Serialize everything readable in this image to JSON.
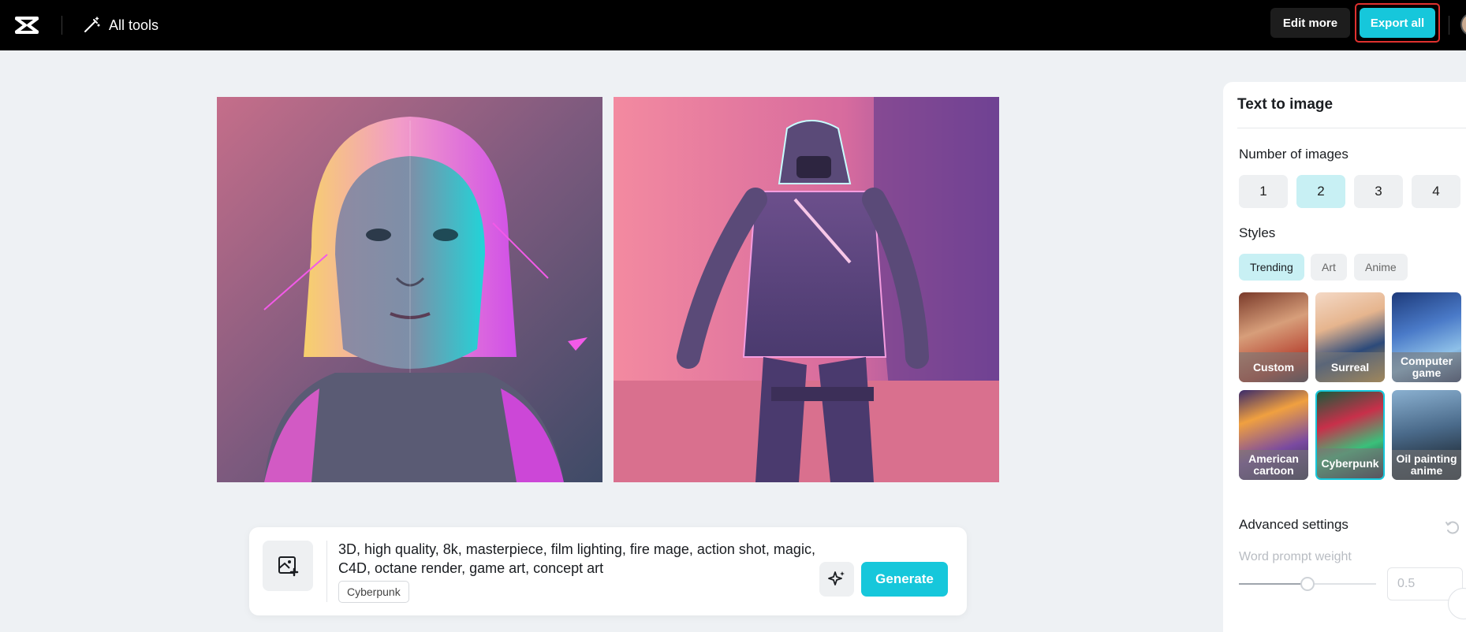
{
  "header": {
    "logo_icon": "capcut-logo-icon",
    "all_tools_label": "All tools",
    "edit_more_label": "Edit more",
    "export_all_label": "Export all"
  },
  "canvas": {
    "images": [
      {
        "subject": "generated-image-1"
      },
      {
        "subject": "generated-image-2"
      }
    ]
  },
  "prompt": {
    "text": "3D, high quality, 8k, masterpiece, film lighting, fire mage, action shot, magic, C4D, octane render, game art, concept art",
    "style_tag": "Cyberpunk",
    "generate_label": "Generate"
  },
  "panel": {
    "title": "Text to image",
    "number_label": "Number of images",
    "numbers": [
      "1",
      "2",
      "3",
      "4"
    ],
    "selected_number": "2",
    "styles_label": "Styles",
    "style_tabs": [
      "Trending",
      "Art",
      "Anime"
    ],
    "active_style_tab": "Trending",
    "style_thumbs": [
      {
        "label": "Custom"
      },
      {
        "label": "Surreal"
      },
      {
        "label": "Computer game"
      },
      {
        "label": "American cartoon"
      },
      {
        "label": "Cyberpunk"
      },
      {
        "label": "Oil painting anime"
      }
    ],
    "selected_style": "Cyberpunk",
    "advanced_label": "Advanced settings",
    "word_weight_label": "Word prompt weight",
    "word_weight_value": "0.5"
  },
  "colors": {
    "accent": "#16c7db",
    "topbar": "#000000",
    "background": "#eef1f4",
    "highlight_border": "#e0312f"
  }
}
